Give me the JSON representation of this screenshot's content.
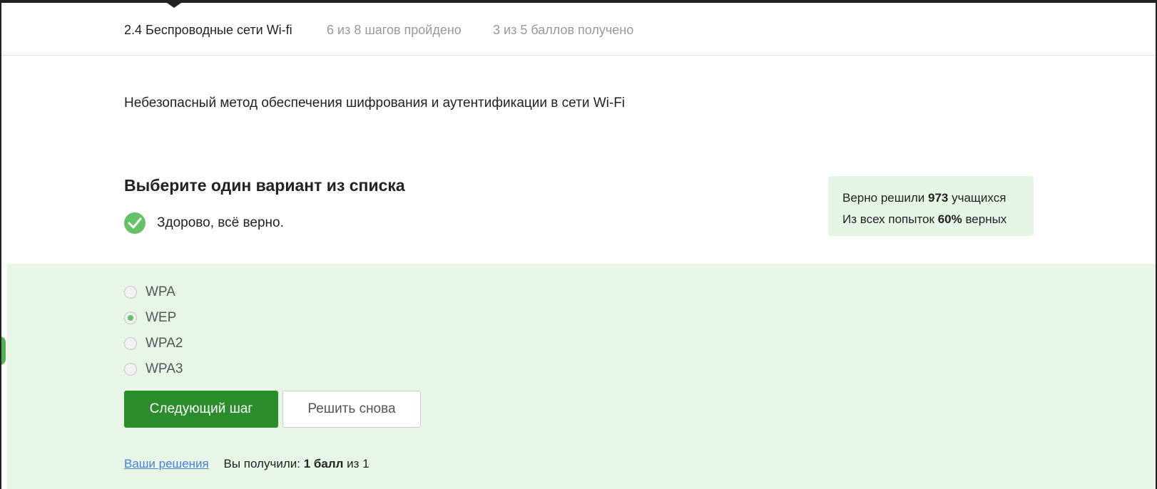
{
  "header": {
    "title": "2.4 Беспроводные сети Wi-fi",
    "steps": "6 из 8 шагов пройдено",
    "score": "3 из 5 баллов  получено"
  },
  "question": {
    "text": "Небезопасный метод обеспечения шифрования и аутентификации в сети Wi-Fi"
  },
  "quiz": {
    "title": "Выберите один вариант из списка",
    "feedback": "Здорово, всё верно.",
    "options": [
      {
        "label": "WPA",
        "selected": false
      },
      {
        "label": "WEP",
        "selected": true
      },
      {
        "label": "WPA2",
        "selected": false
      },
      {
        "label": "WPA3",
        "selected": false
      }
    ]
  },
  "stats": {
    "line1_prefix": "Верно решили ",
    "solved_count": "973",
    "line1_suffix": " учащихся",
    "line2_prefix": "Из всех попыток ",
    "percent": "60%",
    "line2_suffix": " верных"
  },
  "buttons": {
    "next": "Следующий шаг",
    "retry": "Решить снова"
  },
  "footer": {
    "solutions_link": "Ваши решения",
    "score_prefix": "Вы получили: ",
    "score_value": "1 балл",
    "score_suffix": " из 1"
  },
  "colors": {
    "accent_green": "#2a8c2a",
    "check_green": "#66c266",
    "panel_bg": "#e8f6e8",
    "stats_bg": "#e6f6e6",
    "link_blue": "#4a7fd6"
  }
}
